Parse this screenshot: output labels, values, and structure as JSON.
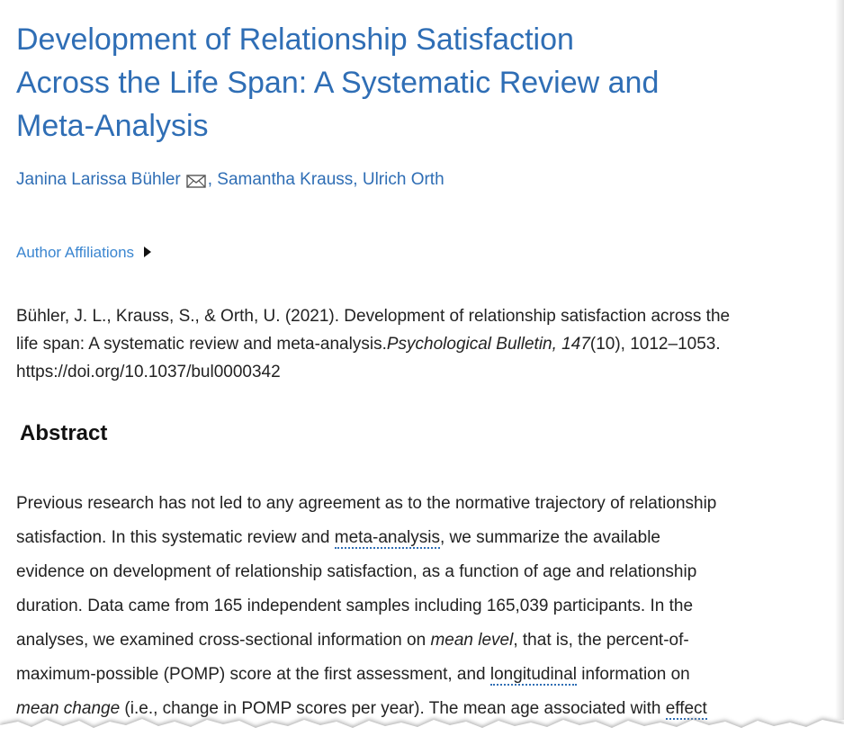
{
  "article": {
    "title_lines": [
      "Development of Relationship Satisfaction",
      "Across the Life Span: A Systematic Review and",
      "Meta-Analysis"
    ],
    "authors": {
      "first": "Janina Larissa Bühler",
      "icon": "envelope-icon",
      "rest": ", Samantha Krauss, Ulrich Orth"
    },
    "affiliations_label": "Author Affiliations",
    "citation": {
      "line1": "Bühler, J. L., Krauss, S., & Orth, U. (2021). Development of relationship satisfaction across the",
      "line2_pre": "life span: A systematic review and meta-analysis.",
      "journal": "Psychological Bulletin, 147",
      "issue": "(10), 1012–1053.",
      "doi": "https://doi.org/10.1037/bul0000342"
    },
    "abstract_heading": "Abstract",
    "abstract": {
      "l1": "Previous research has not led to any agreement as to the normative trajectory of relationship",
      "l2_a": "satisfaction. In this systematic review and ",
      "l2_term": "meta-analysis",
      "l2_b": ", we summarize the available",
      "l3": "evidence on development of relationship satisfaction, as a function of age and relationship",
      "l4": "duration. Data came from 165 independent samples including 165,039 participants. In the",
      "l5_a": "analyses, we examined cross-sectional information on ",
      "l5_em": "mean level",
      "l5_b": ", that is, the percent-of-",
      "l6_a": "maximum-possible (POMP) score at the first assessment, and ",
      "l6_term": "longitudinal",
      "l6_b": " information on",
      "l7_em": "mean change",
      "l7_a": " (i.e., change in POMP scores per year). The mean age associated with ",
      "l7_term": "effect"
    }
  },
  "colors": {
    "title": "#2f6eb5",
    "link": "#3b86d0",
    "text": "#222222"
  }
}
